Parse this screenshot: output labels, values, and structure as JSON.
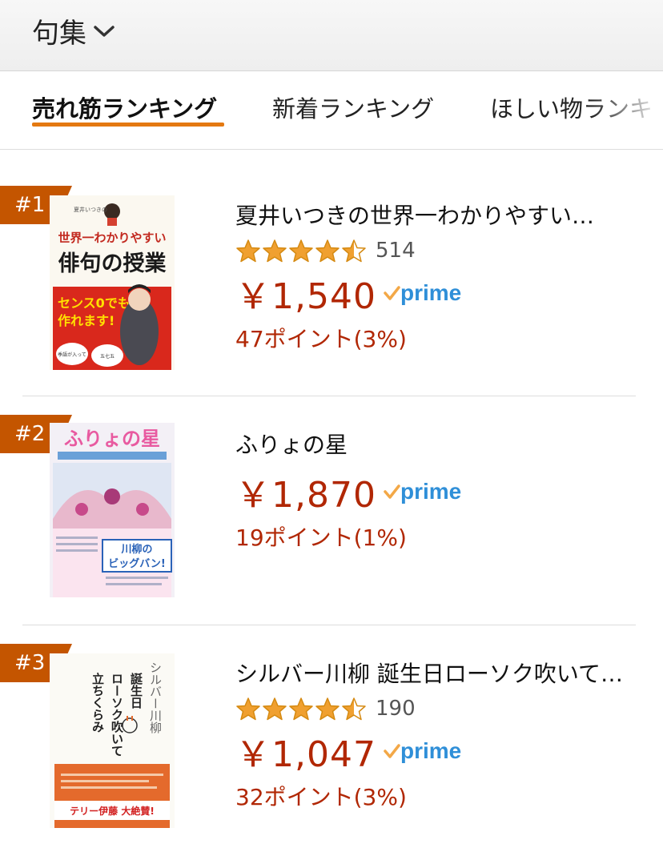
{
  "header": {
    "title": "句集"
  },
  "tabs": [
    {
      "label": "売れ筋ランキング"
    },
    {
      "label": "新着ランキング"
    },
    {
      "label": "ほしい物ランキ"
    }
  ],
  "items": [
    {
      "rank": "#1",
      "title": "夏井いつきの世界一わかりやすい…",
      "rating": 4.5,
      "review_count": "514",
      "price": "￥1,540",
      "prime": "prime",
      "points": "47ポイント(3%)",
      "cover": {
        "top_small": "夏井いつきの",
        "line1": "世界一わかりやすい",
        "line2": "俳句の授業",
        "box1": "センス0でも、",
        "box2": "作れます!",
        "bubble1": "季語が入って",
        "bubble2": "五七五"
      }
    },
    {
      "rank": "#2",
      "title": "ふりょの星",
      "price": "￥1,870",
      "prime": "prime",
      "points": "19ポイント(1%)",
      "cover": {
        "title_art": "ふりょの星",
        "banner1": "川柳の",
        "banner2": "ビッグバン!"
      }
    },
    {
      "rank": "#3",
      "title": "シルバー川柳 誕生日ローソク吹いて…",
      "rating": 4.5,
      "review_count": "190",
      "price": "￥1,047",
      "prime": "prime",
      "points": "32ポイント(3%)",
      "cover": {
        "col1": "シルバー川柳",
        "col2": "誕生日",
        "col3": "ローソク吹いて",
        "col4": "立ちくらみ",
        "band": "テリー伊藤 大絶賛!"
      }
    }
  ],
  "colors": {
    "accent": "#e47911",
    "price": "#b12704",
    "rank_badge": "#c45500",
    "star": "#f0a030",
    "prime_blue": "#2f8fd8",
    "prime_check": "#f3a847"
  }
}
